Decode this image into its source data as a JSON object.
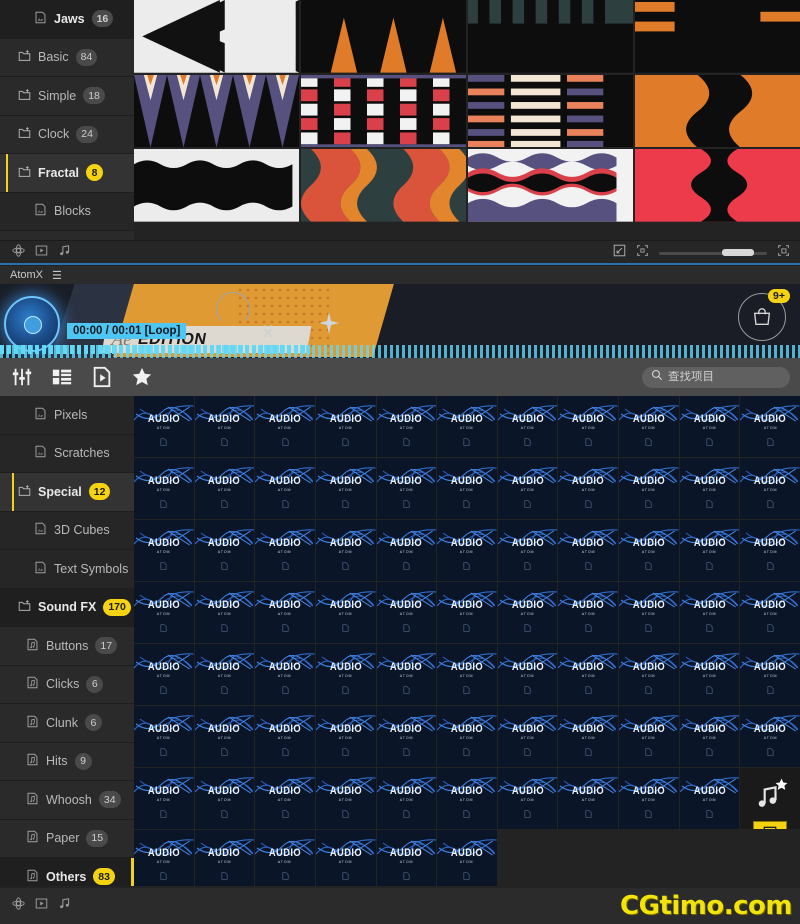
{
  "top_panel": {
    "categories": [
      {
        "label": "Jaws",
        "count": "16",
        "level": 1,
        "state": "active-dark",
        "icon": "ae-file-icon"
      },
      {
        "label": "Basic",
        "count": "84",
        "level": 0,
        "state": "normal",
        "icon": "folder-icon"
      },
      {
        "label": "Simple",
        "count": "18",
        "level": 0,
        "state": "normal",
        "icon": "folder-icon"
      },
      {
        "label": "Clock",
        "count": "24",
        "level": 0,
        "state": "normal",
        "icon": "folder-icon"
      },
      {
        "label": "Fractal",
        "count": "8",
        "level": 0,
        "state": "active",
        "icon": "folder-icon"
      },
      {
        "label": "Blocks",
        "count": "",
        "level": 1,
        "state": "normal",
        "icon": "ae-file-icon"
      }
    ],
    "bottom_icons": [
      "atom-icon",
      "play-file-icon",
      "music-note-icon"
    ],
    "right_icons": [
      "expand-icon",
      "fit-icon",
      "fullscreen-icon"
    ],
    "zoom_value": "58"
  },
  "atomx": {
    "tab_label": "AtomX",
    "menu_icon": "hamburger-icon",
    "banner": {
      "timecode": "00:00 / 00:01 [Loop]",
      "ae_mark": "Ae",
      "edition": "EDITION",
      "cart_badge": "9+",
      "cart_icon": "shopping-bag-icon",
      "close_icon": "close-icon"
    },
    "toolbar": {
      "icons": [
        {
          "name": "sliders-icon",
          "label": "Filters"
        },
        {
          "name": "list-icon",
          "label": "Library"
        },
        {
          "name": "file-play-icon",
          "label": "Presets"
        },
        {
          "name": "star-icon",
          "label": "Favorites"
        }
      ]
    },
    "search": {
      "placeholder": "查找项目",
      "value": "",
      "icon": "search-icon"
    },
    "categories": [
      {
        "label": "Pixels",
        "count": "",
        "level": 2,
        "state": "normal",
        "icon": "ae-file-icon"
      },
      {
        "label": "Scratches",
        "count": "",
        "level": 2,
        "state": "normal",
        "icon": "ae-file-icon"
      },
      {
        "label": "Special",
        "count": "12",
        "level": 1,
        "state": "active",
        "icon": "folder-icon"
      },
      {
        "label": "3D Cubes",
        "count": "",
        "level": 2,
        "state": "normal",
        "icon": "ae-file-icon"
      },
      {
        "label": "Text Symbols",
        "count": "",
        "level": 2,
        "state": "normal",
        "icon": "ae-file-icon"
      },
      {
        "label": "Sound FX",
        "count": "170",
        "level": 0,
        "state": "active-dark",
        "icon": "folder-icon"
      },
      {
        "label": "Buttons",
        "count": "17",
        "level": 1,
        "state": "normal",
        "icon": "audio-file-icon"
      },
      {
        "label": "Clicks",
        "count": "6",
        "level": 1,
        "state": "normal",
        "icon": "audio-file-icon"
      },
      {
        "label": "Clunk",
        "count": "6",
        "level": 1,
        "state": "normal",
        "icon": "audio-file-icon"
      },
      {
        "label": "Hits",
        "count": "9",
        "level": 1,
        "state": "normal",
        "icon": "audio-file-icon"
      },
      {
        "label": "Whoosh",
        "count": "34",
        "level": 1,
        "state": "normal",
        "icon": "audio-file-icon"
      },
      {
        "label": "Paper",
        "count": "15",
        "level": 1,
        "state": "normal",
        "icon": "audio-file-icon"
      },
      {
        "label": "Others",
        "count": "83",
        "level": 1,
        "state": "active-dark",
        "icon": "audio-file-icon"
      }
    ],
    "grid": {
      "item_title": "AUDIO",
      "item_subtitle": "ATOM",
      "columns": 11,
      "full_rows": 7,
      "last_row_count": 6,
      "hover_index": 76,
      "hover": {
        "note_icon": "music-note-icon",
        "star_icon": "star-outline-icon",
        "add_icon": "add-to-comp-icon"
      }
    }
  },
  "status_bar": {
    "icons": [
      "atom-icon",
      "play-file-icon",
      "music-note-icon"
    ],
    "watermark": "CGtimo.com"
  },
  "colors": {
    "accent_yellow": "#f5d312",
    "card_bg": "#0b1528",
    "panel_bg": "#232323",
    "sidebar_bg": "#2a2a2a",
    "toolbar_bg": "#4a4a4a",
    "wave_blue": "#2f6fd0"
  }
}
